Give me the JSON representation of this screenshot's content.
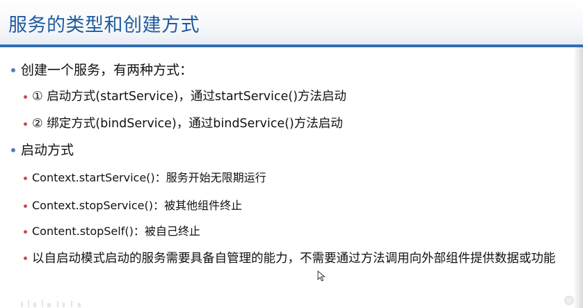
{
  "slide": {
    "title": "服务的类型和创建方式"
  },
  "bullets": [
    {
      "level": 1,
      "text": "创建一个服务，有两种方式："
    },
    {
      "level": 2,
      "text": "① 启动方式(startService)，通过startService()方法启动"
    },
    {
      "level": 2,
      "text": "② 绑定方式(bindService)，通过bindService()方法启动"
    },
    {
      "level": 1,
      "text": "启动方式"
    },
    {
      "level": 2,
      "text": "Context.startService()：服务开始无限期运行"
    },
    {
      "level": 2,
      "text": "Context.stopService()：被其他组件终止"
    },
    {
      "level": 2,
      "text": "Content.stopSelf()：被自己终止"
    },
    {
      "level": 2,
      "text": "以自启动模式启动的服务需要具备自管理的能力，不需要通过方法调用向外部组件提供数据或功能"
    }
  ],
  "colors": {
    "title": "#1f5b9e",
    "title_rule": "#2f6db4",
    "level1_bullet": "#4f81bd",
    "level2_bullet": "#c0504d",
    "text": "#111111"
  },
  "icons": {
    "cursor": "arrow-cursor-icon"
  }
}
